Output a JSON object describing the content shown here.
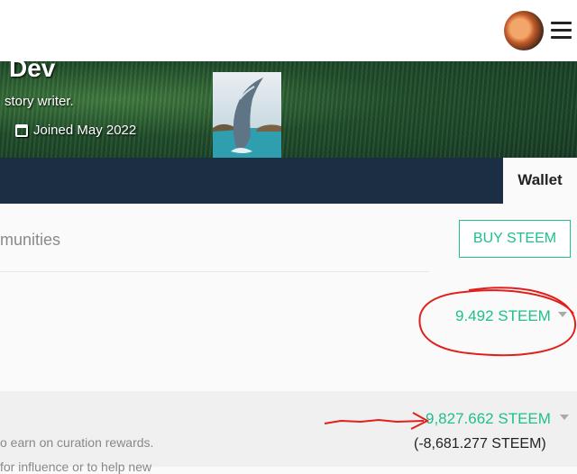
{
  "profile": {
    "name": "Dev",
    "about": "story writer.",
    "joined": "Joined May 2022"
  },
  "nav": {
    "active_tab": "Wallet"
  },
  "subnav": {
    "communities_label": "munities",
    "buy_button": "BUY STEEM"
  },
  "balances": {
    "steem": "9.492 STEEM",
    "steem_power": "9,827.662 STEEM",
    "steem_power_delegated": "(-8,681.277 STEEM)",
    "sp_description_line1": "o earn on curation rewards.",
    "sp_description_line2": "for influence or to help new"
  },
  "colors": {
    "accent": "#1fbf8f",
    "navbar": "#1b2e44",
    "annotation": "#e0201c"
  },
  "icons": {
    "calendar": "calendar-icon",
    "menu": "hamburger-menu-icon",
    "caret": "caret-down-icon"
  }
}
